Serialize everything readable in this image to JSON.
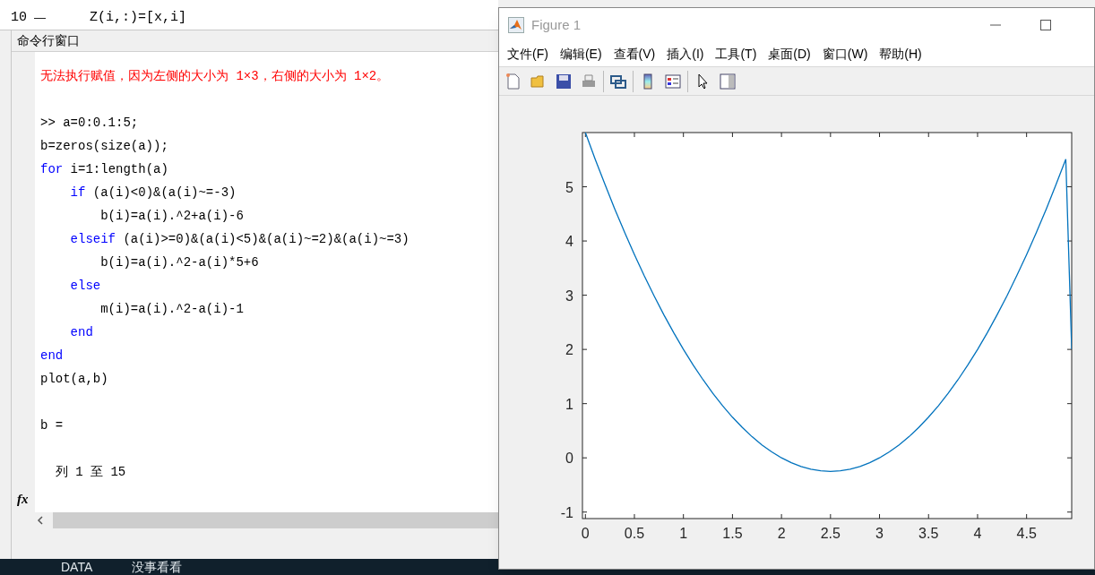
{
  "editor": {
    "lines": [
      {
        "number": "10",
        "marker": "—",
        "code": "Z(i,:)=[x,i]"
      }
    ]
  },
  "command_window": {
    "title": "命令行窗口",
    "lines": [
      {
        "kind": "error",
        "segments": [
          {
            "text": "无法执行赋值，因为左侧的大小为 1×3，右侧的大小为 1×2。",
            "kind": "plain"
          }
        ]
      },
      {
        "kind": "blank"
      },
      {
        "kind": "code",
        "segments": [
          {
            "text": ">> a=0:0.1:5;",
            "kind": "plain"
          }
        ]
      },
      {
        "kind": "code",
        "segments": [
          {
            "text": "b=zeros(size(a));",
            "kind": "plain"
          }
        ]
      },
      {
        "kind": "code",
        "segments": [
          {
            "text": "for",
            "kind": "keyword"
          },
          {
            "text": " i=1:length(a)",
            "kind": "plain"
          }
        ]
      },
      {
        "kind": "code",
        "segments": [
          {
            "text": "    if",
            "kind": "keyword"
          },
          {
            "text": " (a(i)<0)&(a(i)~=-3)",
            "kind": "plain"
          }
        ]
      },
      {
        "kind": "code",
        "segments": [
          {
            "text": "        b(i)=a(i).^2+a(i)-6",
            "kind": "plain"
          }
        ]
      },
      {
        "kind": "code",
        "segments": [
          {
            "text": "    elseif",
            "kind": "keyword"
          },
          {
            "text": " (a(i)>=0)&(a(i)<5)&(a(i)~=2)&(a(i)~=3)",
            "kind": "plain"
          }
        ]
      },
      {
        "kind": "code",
        "segments": [
          {
            "text": "        b(i)=a(i).^2-a(i)*5+6",
            "kind": "plain"
          }
        ]
      },
      {
        "kind": "code",
        "segments": [
          {
            "text": "    else",
            "kind": "keyword"
          }
        ]
      },
      {
        "kind": "code",
        "segments": [
          {
            "text": "        m(i)=a(i).^2-a(i)-1",
            "kind": "plain"
          }
        ]
      },
      {
        "kind": "code",
        "segments": [
          {
            "text": "    end",
            "kind": "keyword"
          }
        ]
      },
      {
        "kind": "code",
        "segments": [
          {
            "text": "end",
            "kind": "keyword"
          }
        ]
      },
      {
        "kind": "code",
        "segments": [
          {
            "text": "plot(a,b)",
            "kind": "plain"
          }
        ]
      },
      {
        "kind": "blank"
      },
      {
        "kind": "output",
        "segments": [
          {
            "text": "b =",
            "kind": "plain"
          }
        ]
      },
      {
        "kind": "blank"
      },
      {
        "kind": "output",
        "segments": [
          {
            "text": "  列 1 至 15",
            "kind": "plain"
          }
        ]
      }
    ],
    "prompt_icon": "fx"
  },
  "figure": {
    "title": "Figure 1",
    "menu": [
      "文件(F)",
      "编辑(E)",
      "查看(V)",
      "插入(I)",
      "工具(T)",
      "桌面(D)",
      "窗口(W)",
      "帮助(H)"
    ],
    "chart_data": {
      "type": "line",
      "xlim": [
        -0.03,
        4.96
      ],
      "ylim": [
        -1.12,
        6
      ],
      "xticks": [
        0,
        0.5,
        1,
        1.5,
        2,
        2.5,
        3,
        3.5,
        4,
        4.5
      ],
      "yticks": [
        -1,
        0,
        1,
        2,
        3,
        4,
        5
      ],
      "x": [
        0,
        0.1,
        0.2,
        0.3,
        0.4,
        0.5,
        0.6,
        0.7,
        0.8,
        0.9,
        1,
        1.1,
        1.2,
        1.3,
        1.4,
        1.5,
        1.6,
        1.7,
        1.8,
        1.9,
        2,
        2.1,
        2.2,
        2.3,
        2.4,
        2.5,
        2.6,
        2.7,
        2.8,
        2.9,
        3,
        3.1,
        3.2,
        3.3,
        3.4,
        3.5,
        3.6,
        3.7,
        3.8,
        3.9,
        4,
        4.1,
        4.2,
        4.3,
        4.4,
        4.5,
        4.6,
        4.7,
        4.8,
        4.9,
        4.96
      ],
      "series": [
        {
          "color": "#0072bd",
          "values": [
            6,
            5.51,
            5.04,
            4.59,
            4.16,
            3.75,
            3.36,
            2.99,
            2.64,
            2.31,
            2,
            1.71,
            1.44,
            1.19,
            0.96,
            0.75,
            0.56,
            0.39,
            0.24,
            0.11,
            0,
            -0.09,
            -0.16,
            -0.21,
            -0.24,
            -0.25,
            -0.24,
            -0.21,
            -0.16,
            -0.09,
            0,
            0.11,
            0.24,
            0.39,
            0.56,
            0.75,
            0.96,
            1.19,
            1.44,
            1.71,
            2,
            2.31,
            2.64,
            2.99,
            3.36,
            3.75,
            4.16,
            4.59,
            5.04,
            5.51,
            2
          ]
        }
      ]
    }
  },
  "taskbar": {
    "items": [
      "DATA",
      "没事看看"
    ]
  }
}
